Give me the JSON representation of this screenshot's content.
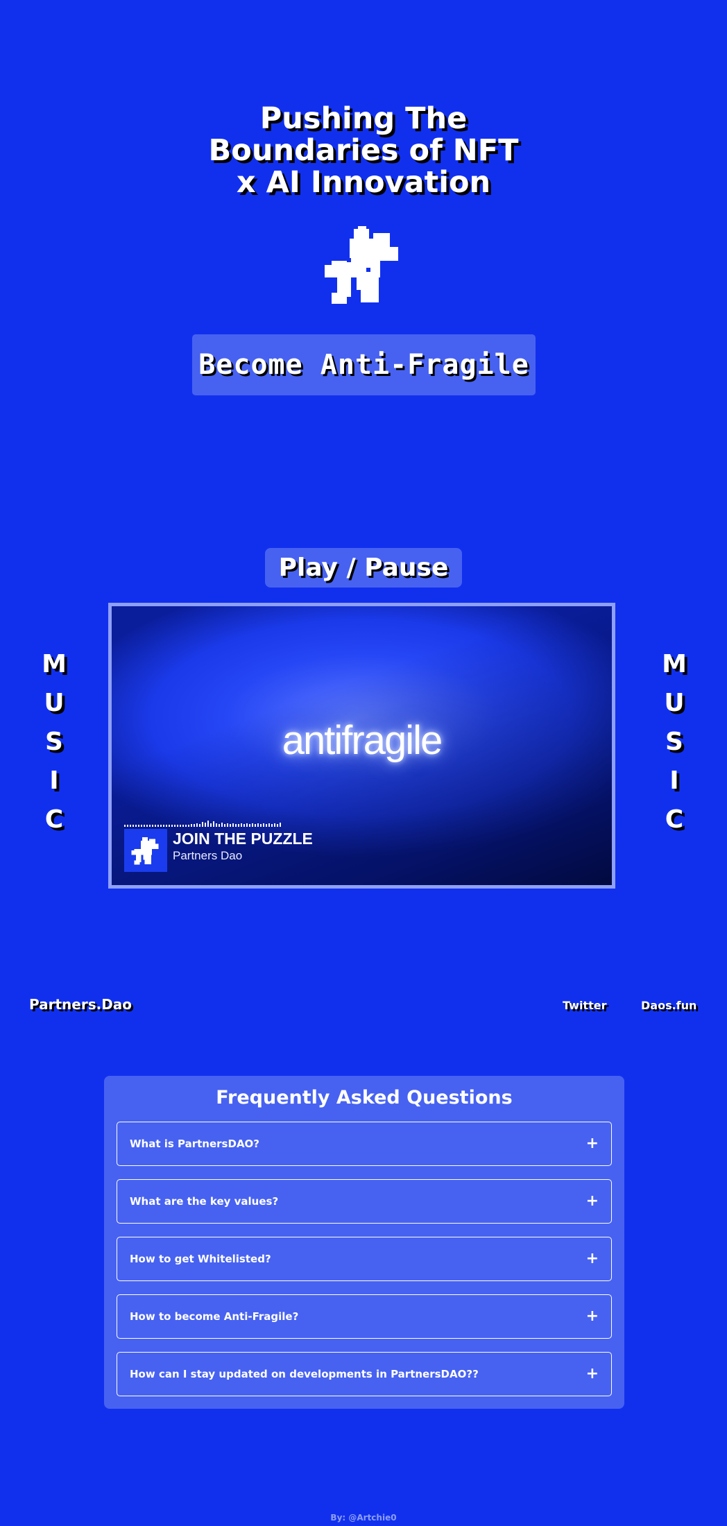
{
  "hero": {
    "title_lines": [
      "Pushing The",
      "Boundaries of NFT",
      "x AI Innovation"
    ],
    "logo_icon": "puzzle-piece-icon",
    "cta_label": "Become Anti-Fragile"
  },
  "player": {
    "play_label": "Play / Pause",
    "side_label_letters": [
      "M",
      "U",
      "S",
      "I",
      "C"
    ],
    "video": {
      "overlay_word": "antifragile",
      "track_title": "JOIN THE PUZZLE",
      "track_artist": "Partners Dao",
      "badge_icon": "puzzle-piece-icon"
    }
  },
  "footer_nav": {
    "brand": "Partners.Dao",
    "links": [
      "Twitter",
      "Daos.fun"
    ]
  },
  "faq": {
    "title": "Frequently Asked Questions",
    "expand_icon": "plus-icon",
    "items": [
      {
        "question": "What is PartnersDAO?"
      },
      {
        "question": "What are the key values?"
      },
      {
        "question": "How to get Whitelisted?"
      },
      {
        "question": "How to become Anti-Fragile?"
      },
      {
        "question": "How can I stay updated on developments in PartnersDAO??"
      }
    ]
  },
  "credit": "By: @Artchie0",
  "colors": {
    "background": "#1130ee",
    "panel": "#4762f1",
    "frame_border": "#8ea0f8",
    "text": "#ffffff",
    "shadow": "#000000",
    "credit_text": "#8e9ef5"
  }
}
